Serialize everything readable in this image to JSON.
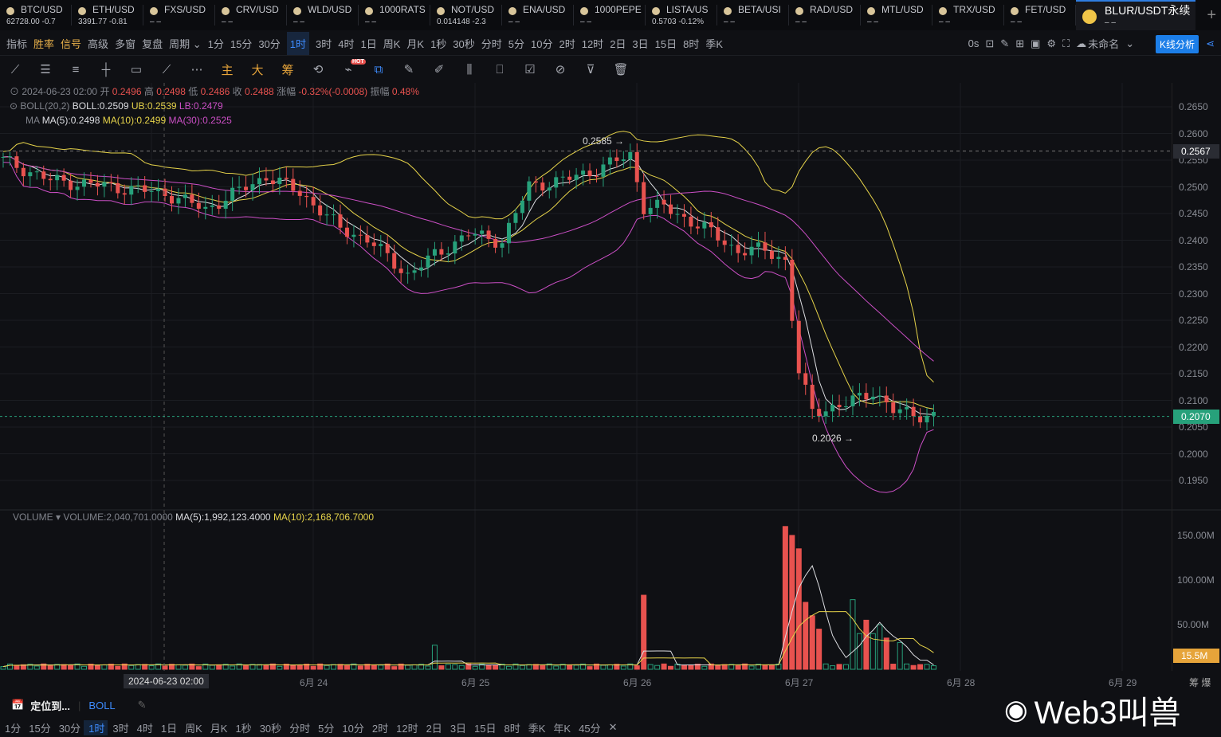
{
  "tickers": [
    {
      "symbol": "BTC/USD",
      "price": "62728.00 -0.7"
    },
    {
      "symbol": "ETH/USD",
      "price": "3391.77 -0.81"
    },
    {
      "symbol": "FXS/USD",
      "price": "– –"
    },
    {
      "symbol": "CRV/USD",
      "price": "– –"
    },
    {
      "symbol": "WLD/USD",
      "price": "– –"
    },
    {
      "symbol": "1000RATS",
      "price": "– –"
    },
    {
      "symbol": "NOT/USD",
      "price": "0.014148 -2.3"
    },
    {
      "symbol": "ENA/USD",
      "price": "– –"
    },
    {
      "symbol": "1000PEPE",
      "price": "– –"
    },
    {
      "symbol": "LISTA/US",
      "price": "0.5703 -0.12%"
    },
    {
      "symbol": "BETA/USI",
      "price": "– –"
    },
    {
      "symbol": "RAD/USD",
      "price": "– –"
    },
    {
      "symbol": "MTL/USD",
      "price": "– –"
    },
    {
      "symbol": "TRX/USD",
      "price": "– –"
    },
    {
      "symbol": "FET/USD",
      "price": "– –"
    },
    {
      "symbol": "BLUR/USDT永续",
      "price": "– –"
    }
  ],
  "toolbar": {
    "left": [
      "指标",
      "胜率",
      "信号",
      "高级",
      "多窗",
      "复盘",
      "周期 ⌄"
    ],
    "intervals": [
      "1分",
      "15分",
      "30分",
      "1时",
      "3时",
      "4时",
      "1日",
      "周K",
      "月K",
      "1秒",
      "30秒",
      "分时",
      "5分",
      "10分",
      "2时",
      "12时",
      "2日",
      "3日",
      "15日",
      "8时",
      "季K"
    ],
    "selected_interval": "1时",
    "countdown": "0s",
    "layout_name": "未命名",
    "analysis_button": "K线分析"
  },
  "draw_tools": {
    "labels": [
      "主",
      "大",
      "筹"
    ],
    "hot_badge": "HOT"
  },
  "legend": {
    "time": "2024-06-23 02:00",
    "open_label": "开",
    "open": "0.2496",
    "high_label": "高",
    "high": "0.2498",
    "low_label": "低",
    "low": "0.2486",
    "close_label": "收",
    "close": "0.2488",
    "change_label": "涨幅",
    "change": "-0.32%(-0.0008)",
    "amp_label": "振幅",
    "amp": "0.48%",
    "boll_name": "BOLL(20,2)",
    "boll": "BOLL:0.2509",
    "ub": "UB:0.2539",
    "lb": "LB:0.2479",
    "ma_name": "MA",
    "ma5": "MA(5):0.2498",
    "ma10": "MA(10):0.2499",
    "ma30": "MA(30):0.2525"
  },
  "volume_legend": {
    "name": "VOLUME",
    "volume": "VOLUME:2,040,701.0000",
    "ma5": "MA(5):1,992,123.4000",
    "ma10": "MA(10):2,168,706.7000"
  },
  "price_axis": {
    "ticks": [
      "0.2650",
      "0.2600",
      "0.2550",
      "0.2500",
      "0.2450",
      "0.2400",
      "0.2350",
      "0.2300",
      "0.2250",
      "0.2200",
      "0.2150",
      "0.2100",
      "0.2050",
      "0.2000",
      "0.1950"
    ],
    "crosshair_price": "0.2567",
    "last_price": "0.2070",
    "high_mark": "0.2585",
    "low_mark": "0.2026"
  },
  "volume_axis": {
    "ticks": [
      "150.00M",
      "100.00M",
      "50.00M"
    ],
    "last_volume": "15.5M"
  },
  "time_axis": {
    "crosshair_time": "2024-06-23 02:00",
    "labels": [
      "6月 24",
      "6月 25",
      "6月 26",
      "6月 27",
      "6月 28",
      "6月 29"
    ],
    "right_labels": "筹 爆"
  },
  "bottom": {
    "locate": "定位到...",
    "indicator": "BOLL",
    "intervals": [
      "1分",
      "15分",
      "30分",
      "1时",
      "3时",
      "4时",
      "1日",
      "周K",
      "月K",
      "1秒",
      "30秒",
      "分时",
      "5分",
      "10分",
      "2时",
      "12时",
      "2日",
      "3日",
      "15日",
      "8时",
      "季K",
      "年K",
      "45分"
    ],
    "selected": "1时"
  },
  "watermark": "Web3叫兽",
  "chart_data": {
    "type": "candlestick",
    "interval": "1h",
    "ylim": [
      0.1925,
      0.2675
    ],
    "price_path": [
      [
        0,
        0.255
      ],
      [
        7,
        0.2512
      ],
      [
        15,
        0.2502
      ],
      [
        24,
        0.2488
      ],
      [
        30,
        0.2458
      ],
      [
        39,
        0.252
      ],
      [
        44,
        0.249
      ],
      [
        50,
        0.2422
      ],
      [
        54,
        0.2402
      ],
      [
        60,
        0.2335
      ],
      [
        64,
        0.2372
      ],
      [
        69,
        0.2412
      ],
      [
        74,
        0.2398
      ],
      [
        78,
        0.2502
      ],
      [
        83,
        0.2512
      ],
      [
        88,
        0.2532
      ],
      [
        93,
        0.256
      ],
      [
        95,
        0.2462
      ],
      [
        98,
        0.2462
      ],
      [
        104,
        0.2422
      ],
      [
        109,
        0.238
      ],
      [
        113,
        0.2382
      ],
      [
        116,
        0.2362
      ],
      [
        118,
        0.215
      ],
      [
        120,
        0.208
      ],
      [
        125,
        0.2092
      ],
      [
        129,
        0.2118
      ],
      [
        132,
        0.208
      ],
      [
        138,
        0.207
      ]
    ],
    "volume_base_m": 3,
    "volume_spikes_m": [
      [
        64,
        27
      ],
      [
        95,
        83
      ],
      [
        116,
        160
      ],
      [
        117,
        150
      ],
      [
        118,
        135
      ],
      [
        119,
        75
      ],
      [
        120,
        60
      ],
      [
        121,
        45
      ],
      [
        126,
        78
      ],
      [
        127,
        40
      ],
      [
        128,
        55
      ],
      [
        129,
        40
      ],
      [
        130,
        50
      ],
      [
        131,
        35
      ],
      [
        133,
        30
      ]
    ],
    "volume_ylim_m": [
      0,
      160
    ]
  }
}
